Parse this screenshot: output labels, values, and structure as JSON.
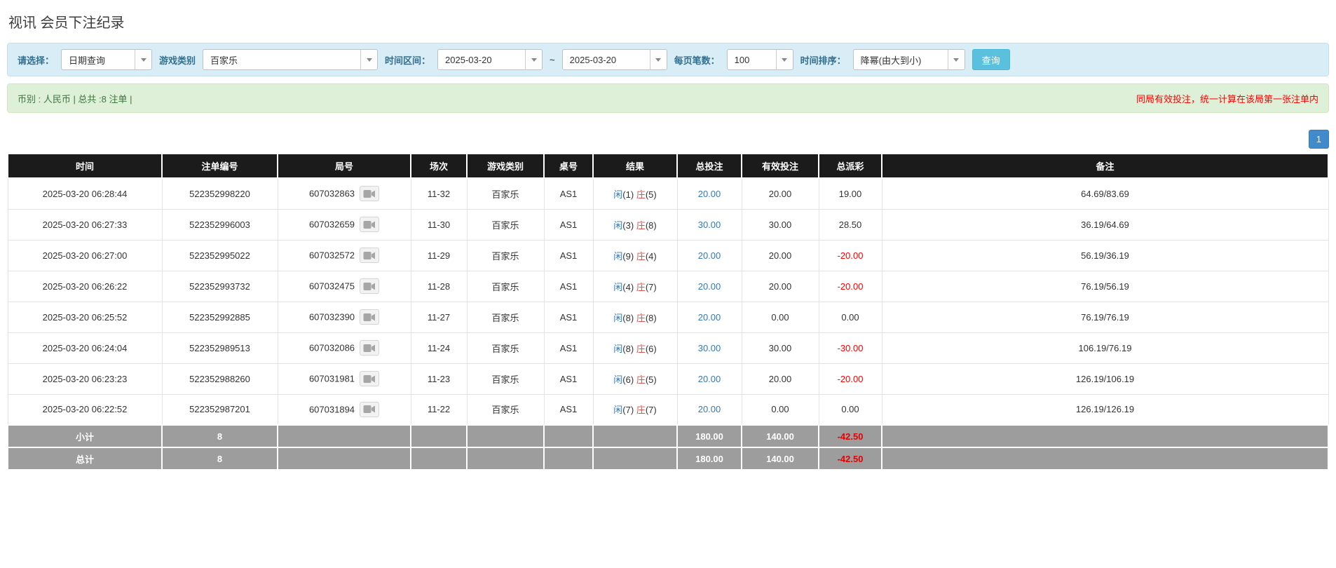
{
  "page": {
    "title": "视讯 会员下注纪录"
  },
  "filters": {
    "select_label": "请选择：",
    "select_value": "日期查询",
    "game_type_label": "游戏类别",
    "game_type_value": "百家乐",
    "time_range_label": "时间区间：",
    "date_from": "2025-03-20",
    "range_separator": "~",
    "date_to": "2025-03-20",
    "per_page_label": "每页笔数：",
    "per_page_value": "100",
    "sort_label": "时间排序：",
    "sort_value": "降幂(由大到小)",
    "query_button": "查询"
  },
  "info_bar": {
    "summary": "币别 : 人民币 | 总共 :8 注单 |",
    "notice": "同局有效投注，统一计算在该局第一张注单内"
  },
  "pagination": {
    "current_page": "1"
  },
  "table": {
    "headers": [
      "时间",
      "注单编号",
      "局号",
      "场次",
      "游戏类别",
      "桌号",
      "结果",
      "总投注",
      "有效投注",
      "总派彩",
      "备注"
    ],
    "rows": [
      {
        "time": "2025-03-20 06:28:44",
        "order_id": "522352998220",
        "round_id": "607032863",
        "session": "11-32",
        "game_type": "百家乐",
        "table_no": "AS1",
        "result": {
          "player": "闲(1)",
          "banker": "庄(5)"
        },
        "total_bet": "20.00",
        "valid_bet": "20.00",
        "payout": "19.00",
        "note": "64.69/83.69"
      },
      {
        "time": "2025-03-20 06:27:33",
        "order_id": "522352996003",
        "round_id": "607032659",
        "session": "11-30",
        "game_type": "百家乐",
        "table_no": "AS1",
        "result": {
          "player": "闲(3)",
          "banker": "庄(8)"
        },
        "total_bet": "30.00",
        "valid_bet": "30.00",
        "payout": "28.50",
        "note": "36.19/64.69"
      },
      {
        "time": "2025-03-20 06:27:00",
        "order_id": "522352995022",
        "round_id": "607032572",
        "session": "11-29",
        "game_type": "百家乐",
        "table_no": "AS1",
        "result": {
          "player": "闲(9)",
          "banker": "庄(4)"
        },
        "total_bet": "20.00",
        "valid_bet": "20.00",
        "payout": "-20.00",
        "note": "56.19/36.19"
      },
      {
        "time": "2025-03-20 06:26:22",
        "order_id": "522352993732",
        "round_id": "607032475",
        "session": "11-28",
        "game_type": "百家乐",
        "table_no": "AS1",
        "result": {
          "player": "闲(4)",
          "banker": "庄(7)"
        },
        "total_bet": "20.00",
        "valid_bet": "20.00",
        "payout": "-20.00",
        "note": "76.19/56.19"
      },
      {
        "time": "2025-03-20 06:25:52",
        "order_id": "522352992885",
        "round_id": "607032390",
        "session": "11-27",
        "game_type": "百家乐",
        "table_no": "AS1",
        "result": {
          "player": "闲(8)",
          "banker": "庄(8)"
        },
        "total_bet": "20.00",
        "valid_bet": "0.00",
        "payout": "0.00",
        "note": "76.19/76.19"
      },
      {
        "time": "2025-03-20 06:24:04",
        "order_id": "522352989513",
        "round_id": "607032086",
        "session": "11-24",
        "game_type": "百家乐",
        "table_no": "AS1",
        "result": {
          "player": "闲(8)",
          "banker": "庄(6)"
        },
        "total_bet": "30.00",
        "valid_bet": "30.00",
        "payout": "-30.00",
        "note": "106.19/76.19"
      },
      {
        "time": "2025-03-20 06:23:23",
        "order_id": "522352988260",
        "round_id": "607031981",
        "session": "11-23",
        "game_type": "百家乐",
        "table_no": "AS1",
        "result": {
          "player": "闲(6)",
          "banker": "庄(5)"
        },
        "total_bet": "20.00",
        "valid_bet": "20.00",
        "payout": "-20.00",
        "note": "126.19/106.19"
      },
      {
        "time": "2025-03-20 06:22:52",
        "order_id": "522352987201",
        "round_id": "607031894",
        "session": "11-22",
        "game_type": "百家乐",
        "table_no": "AS1",
        "result": {
          "player": "闲(7)",
          "banker": "庄(7)"
        },
        "total_bet": "20.00",
        "valid_bet": "0.00",
        "payout": "0.00",
        "note": "126.19/126.19"
      }
    ],
    "subtotal": {
      "label": "小计",
      "count": "8",
      "total_bet": "180.00",
      "valid_bet": "140.00",
      "payout": "-42.50"
    },
    "total": {
      "label": "总计",
      "count": "8",
      "total_bet": "180.00",
      "valid_bet": "140.00",
      "payout": "-42.50"
    }
  },
  "colors": {
    "accent_blue": "#428bca",
    "link_blue": "#337ab7",
    "player_blue": "#337ab7",
    "banker_red": "#d9534f",
    "negative_red": "#ff0000",
    "query_button_bg": "#5bc0de",
    "filter_bar_bg": "#d9edf7",
    "info_bar_bg": "#dff0d8",
    "table_header_bg": "#1b1b1b",
    "footer_row_bg": "#9d9d9d"
  },
  "icons": {
    "caret_icon": "chevron-down",
    "video_icon": "video-camera"
  }
}
